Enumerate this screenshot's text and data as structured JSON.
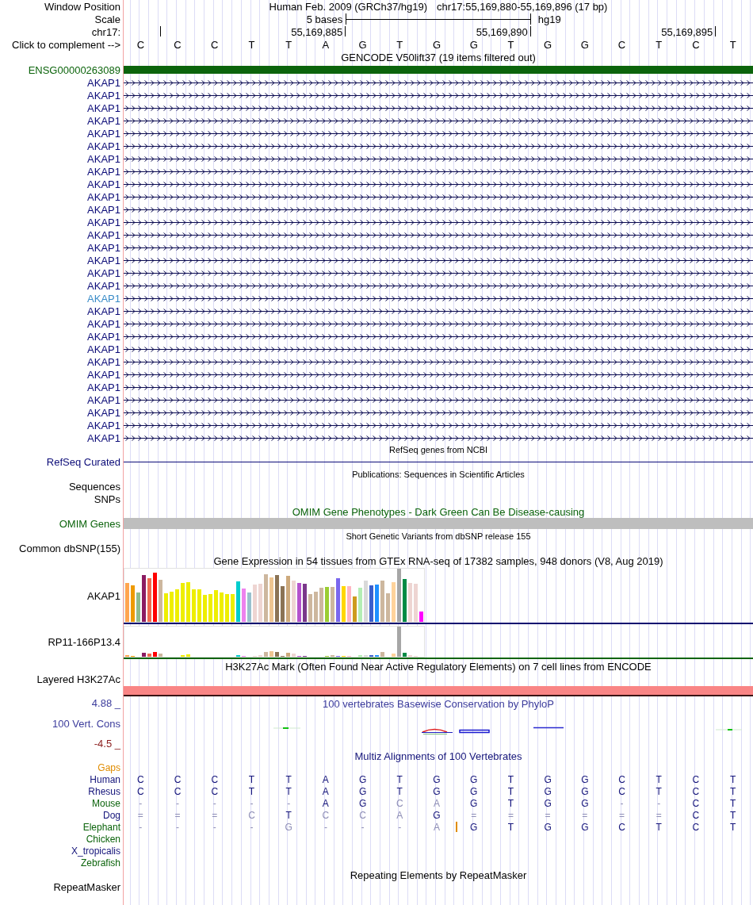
{
  "header": {
    "window_position": {
      "label": "Window Position",
      "assembly": "Human Feb. 2009 (GRCh37/hg19)",
      "position": "chr17:55,169,880-55,169,896 (17 bp)"
    },
    "scale": {
      "label": "Scale",
      "length": "5 bases",
      "assembly": "hg19"
    },
    "ruler": {
      "label": "chr17:",
      "ticks": [
        "55,169,885",
        "55,169,890",
        "55,169,895"
      ]
    },
    "sequence": {
      "label": "Click to complement -->",
      "bases": [
        "C",
        "C",
        "C",
        "T",
        "T",
        "A",
        "G",
        "T",
        "G",
        "G",
        "T",
        "G",
        "G",
        "C",
        "T",
        "C",
        "T"
      ]
    }
  },
  "tracks": [
    {
      "kind": "genes",
      "title": "GENCODE V50lift37 (19 items filtered out)",
      "items": [
        {
          "label": "ENSG00000263089",
          "kind": "bar",
          "color": "#0c640c"
        },
        {
          "label": "AKAP1",
          "kind": "arrow",
          "color": "#0c0c78"
        },
        {
          "label": "AKAP1",
          "kind": "arrow",
          "color": "#0c0c78"
        },
        {
          "label": "AKAP1",
          "kind": "arrow",
          "color": "#0c0c78"
        },
        {
          "label": "AKAP1",
          "kind": "arrow",
          "color": "#0c0c78"
        },
        {
          "label": "AKAP1",
          "kind": "arrow",
          "color": "#0c0c78"
        },
        {
          "label": "AKAP1",
          "kind": "arrow",
          "color": "#0c0c78"
        },
        {
          "label": "AKAP1",
          "kind": "arrow",
          "color": "#0c0c78"
        },
        {
          "label": "AKAP1",
          "kind": "arrow",
          "color": "#0c0c78"
        },
        {
          "label": "AKAP1",
          "kind": "arrow",
          "color": "#0c0c78"
        },
        {
          "label": "AKAP1",
          "kind": "arrow",
          "color": "#0c0c78"
        },
        {
          "label": "AKAP1",
          "kind": "arrow",
          "color": "#0c0c78"
        },
        {
          "label": "AKAP1",
          "kind": "arrow",
          "color": "#0c0c78"
        },
        {
          "label": "AKAP1",
          "kind": "arrow",
          "color": "#0c0c78"
        },
        {
          "label": "AKAP1",
          "kind": "arrow",
          "color": "#0c0c78"
        },
        {
          "label": "AKAP1",
          "kind": "arrow",
          "color": "#0c0c78"
        },
        {
          "label": "AKAP1",
          "kind": "arrow",
          "color": "#0c0c78"
        },
        {
          "label": "AKAP1",
          "kind": "arrow",
          "color": "#0c0c78"
        },
        {
          "label": "AKAP1",
          "kind": "arrow",
          "color": "#3a8cc8"
        },
        {
          "label": "AKAP1",
          "kind": "arrow",
          "color": "#0c0c78"
        },
        {
          "label": "AKAP1",
          "kind": "arrow",
          "color": "#0c0c78"
        },
        {
          "label": "AKAP1",
          "kind": "arrow",
          "color": "#0c0c78"
        },
        {
          "label": "AKAP1",
          "kind": "arrow",
          "color": "#0c0c78"
        },
        {
          "label": "AKAP1",
          "kind": "arrow",
          "color": "#0c0c78"
        },
        {
          "label": "AKAP1",
          "kind": "arrow",
          "color": "#0c0c78"
        },
        {
          "label": "AKAP1",
          "kind": "arrow",
          "color": "#0c0c78"
        },
        {
          "label": "AKAP1",
          "kind": "arrow",
          "color": "#0c0c78"
        },
        {
          "label": "AKAP1",
          "kind": "arrow",
          "color": "#0c0c78"
        },
        {
          "label": "AKAP1",
          "kind": "arrow",
          "color": "#0c0c78"
        },
        {
          "label": "AKAP1",
          "kind": "arrow",
          "color": "#0c0c78"
        }
      ]
    },
    {
      "kind": "line",
      "title": "RefSeq genes from NCBI",
      "label": "RefSeq Curated",
      "color": "#0c0c78"
    },
    {
      "kind": "sequences",
      "title": "Publications: Sequences in Scientific Articles",
      "labels": [
        "Sequences",
        "SNPs"
      ]
    },
    {
      "kind": "bar",
      "title": "OMIM Gene Phenotypes - Dark Green Can Be Disease-causing",
      "label": "OMIM Genes",
      "color": "#0c640c"
    },
    {
      "kind": "variants",
      "title": "Short Genetic Variants from dbSNP release 155",
      "labels": [
        "Common dbSNP(155)"
      ]
    },
    {
      "kind": "expression",
      "title": "Gene Expression in 54 tissues from GTEx RNA-seq of 17382 samples, 948 donors (V8, Aug 2019)",
      "genes": [
        {
          "label": "AKAP1",
          "color": "#0c0c70"
        },
        {
          "label": "RP11-166P13.4",
          "color": "#0c640c"
        }
      ]
    },
    {
      "kind": "layered",
      "title": "H3K27Ac Mark (Often Found Near Active Regulatory Elements) on 7 cell lines from ENCODE",
      "label": "Layered H3K27Ac"
    },
    {
      "kind": "wiggle",
      "title": "100 vertebrates Basewise Conservation by PhyloP",
      "label": "100 Vert. Cons",
      "max": "4.88 _",
      "min": "-4.5 _",
      "color": "#3c3c9c"
    },
    {
      "kind": "alignment",
      "title": "Multiz Alignments of 100 Vertebrates",
      "color": "#14147a",
      "gaps": {
        "label": "Gaps",
        "color": "#e08c00"
      },
      "species": [
        {
          "label": "Human",
          "color": "#14147a",
          "bases": [
            {
              "base": "C",
              "faded": false
            },
            {
              "base": "C",
              "faded": false
            },
            {
              "base": "C",
              "faded": false
            },
            {
              "base": "T",
              "faded": false
            },
            {
              "base": "T",
              "faded": false
            },
            {
              "base": "A",
              "faded": false
            },
            {
              "base": "G",
              "faded": false
            },
            {
              "base": "T",
              "faded": false
            },
            {
              "base": "G",
              "faded": false
            },
            {
              "base": "G",
              "faded": false
            },
            {
              "base": "T",
              "faded": false
            },
            {
              "base": "G",
              "faded": false
            },
            {
              "base": "G",
              "faded": false
            },
            {
              "base": "C",
              "faded": false
            },
            {
              "base": "T",
              "faded": false
            },
            {
              "base": "C",
              "faded": false
            },
            {
              "base": "T",
              "faded": false
            }
          ]
        },
        {
          "label": "Rhesus",
          "color": "#14147a",
          "bases": [
            {
              "base": "C",
              "faded": false
            },
            {
              "base": "C",
              "faded": false
            },
            {
              "base": "C",
              "faded": false
            },
            {
              "base": "T",
              "faded": false
            },
            {
              "base": "T",
              "faded": false
            },
            {
              "base": "A",
              "faded": false
            },
            {
              "base": "G",
              "faded": false
            },
            {
              "base": "T",
              "faded": false
            },
            {
              "base": "G",
              "faded": false
            },
            {
              "base": "G",
              "faded": false
            },
            {
              "base": "T",
              "faded": false
            },
            {
              "base": "G",
              "faded": false
            },
            {
              "base": "G",
              "faded": false
            },
            {
              "base": "C",
              "faded": false
            },
            {
              "base": "T",
              "faded": false
            },
            {
              "base": "C",
              "faded": false
            },
            {
              "base": "T",
              "faded": false
            }
          ]
        },
        {
          "label": "Mouse",
          "color": "#0c640c",
          "bases": [
            {
              "base": "-",
              "faded": true
            },
            {
              "base": "-",
              "faded": true
            },
            {
              "base": "-",
              "faded": true
            },
            {
              "base": "-",
              "faded": true
            },
            {
              "base": "-",
              "faded": true
            },
            {
              "base": "A",
              "faded": false
            },
            {
              "base": "G",
              "faded": false
            },
            {
              "base": "C",
              "faded": true
            },
            {
              "base": "A",
              "faded": true
            },
            {
              "base": "G",
              "faded": false
            },
            {
              "base": "T",
              "faded": false
            },
            {
              "base": "G",
              "faded": false
            },
            {
              "base": "G",
              "faded": false
            },
            {
              "base": "-",
              "faded": true
            },
            {
              "base": "-",
              "faded": true
            },
            {
              "base": "C",
              "faded": false
            },
            {
              "base": "T",
              "faded": false
            }
          ]
        },
        {
          "label": "Dog",
          "color": "#14147a",
          "bases": [
            {
              "base": "=",
              "faded": true
            },
            {
              "base": "=",
              "faded": true
            },
            {
              "base": "=",
              "faded": true
            },
            {
              "base": "C",
              "faded": true
            },
            {
              "base": "T",
              "faded": false
            },
            {
              "base": "C",
              "faded": true
            },
            {
              "base": "C",
              "faded": true
            },
            {
              "base": "A",
              "faded": true
            },
            {
              "base": "G",
              "faded": false
            },
            {
              "base": "=",
              "faded": true
            },
            {
              "base": "=",
              "faded": true
            },
            {
              "base": "=",
              "faded": true
            },
            {
              "base": "=",
              "faded": true
            },
            {
              "base": "=",
              "faded": true
            },
            {
              "base": "=",
              "faded": true
            },
            {
              "base": "C",
              "faded": false
            },
            {
              "base": "T",
              "faded": false
            }
          ]
        },
        {
          "label": "Elephant",
          "color": "#0c640c",
          "bases": [
            {
              "base": "-",
              "faded": true,
              "insertion": false
            },
            {
              "base": "-",
              "faded": true,
              "insertion": false
            },
            {
              "base": "-",
              "faded": true,
              "insertion": false
            },
            {
              "base": "-",
              "faded": true,
              "insertion": false
            },
            {
              "base": "G",
              "faded": true,
              "insertion": false
            },
            {
              "base": "-",
              "faded": true,
              "insertion": false
            },
            {
              "base": "-",
              "faded": true,
              "insertion": false
            },
            {
              "base": "-",
              "faded": true,
              "insertion": false
            },
            {
              "base": "A",
              "faded": true,
              "insertion": true
            },
            {
              "base": "G",
              "faded": false,
              "insertion": false
            },
            {
              "base": "T",
              "faded": false,
              "insertion": false
            },
            {
              "base": "G",
              "faded": false,
              "insertion": false
            },
            {
              "base": "G",
              "faded": false,
              "insertion": false
            },
            {
              "base": "C",
              "faded": false,
              "insertion": false
            },
            {
              "base": "T",
              "faded": false,
              "insertion": false
            },
            {
              "base": "C",
              "faded": false,
              "insertion": false
            },
            {
              "base": "T",
              "faded": false,
              "insertion": false
            }
          ]
        },
        {
          "label": "Chicken",
          "color": "#0c640c"
        },
        {
          "label": "X_tropicalis",
          "color": "#14147a"
        },
        {
          "label": "Zebrafish",
          "color": "#0c640c"
        }
      ]
    },
    {
      "kind": "repeats",
      "title": "Repeating Elements by RepeatMasker",
      "labels": [
        "RepeatMasker"
      ]
    }
  ]
}
